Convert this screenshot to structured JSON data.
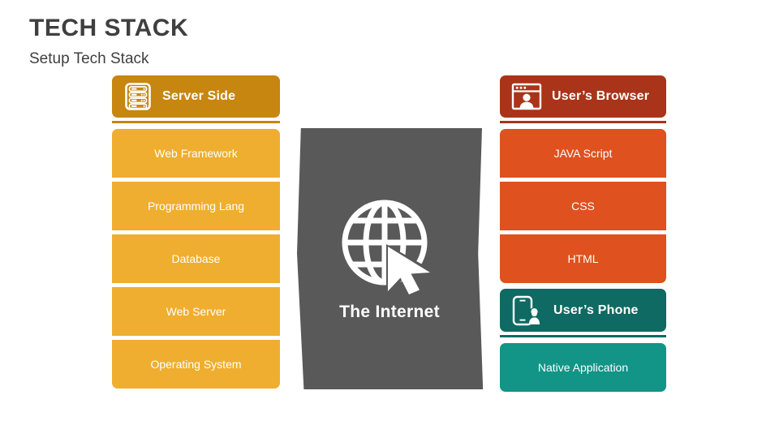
{
  "header": {
    "title": "TECH STACK",
    "subtitle": "Setup Tech Stack"
  },
  "colors": {
    "title_text": "#3f3f3f",
    "server_header": "#c68610",
    "server_item": "#efae2f",
    "browser_header": "#a93419",
    "browser_item": "#df511e",
    "phone_header": "#0e6a63",
    "phone_item": "#129487",
    "internet_slab": "#595959",
    "text_on_block": "#ffffff",
    "page_background": "#ffffff"
  },
  "columns": {
    "server": {
      "header_label": "Server Side",
      "header_icon": "server-rack-icon",
      "items": [
        {
          "label": "Web Framework"
        },
        {
          "label": "Programming Lang"
        },
        {
          "label": "Database"
        },
        {
          "label": "Web Server"
        },
        {
          "label": "Operating System"
        }
      ]
    },
    "browser": {
      "header_label": "User’s Browser",
      "header_icon": "browser-window-user-icon",
      "items": [
        {
          "label": "JAVA Script"
        },
        {
          "label": "CSS"
        },
        {
          "label": "HTML"
        }
      ]
    },
    "phone": {
      "header_label": "User’s Phone",
      "header_icon": "smartphone-user-icon",
      "items": [
        {
          "label": "Native Application"
        }
      ]
    }
  },
  "internet": {
    "label": "The Internet",
    "icon": "globe-cursor-icon"
  }
}
